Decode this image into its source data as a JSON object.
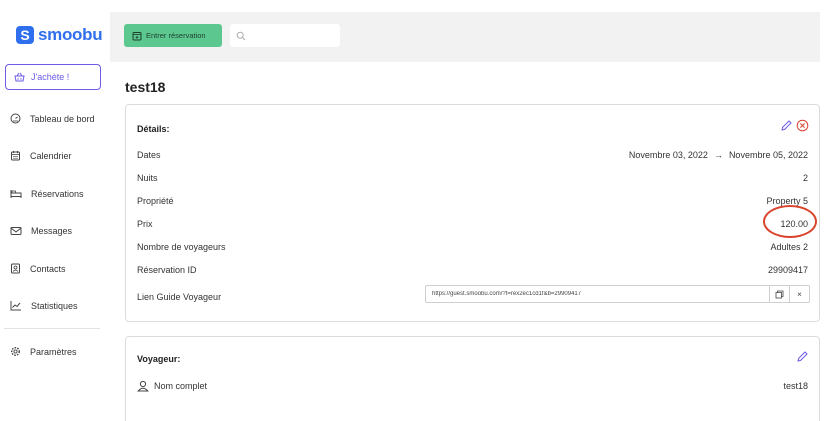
{
  "brand": {
    "name": "smoobu",
    "mark": "S"
  },
  "sidebar": {
    "buy_label": "J'achète !",
    "items": [
      {
        "label": "Tableau de bord",
        "icon": "dashboard-icon"
      },
      {
        "label": "Calendrier",
        "icon": "calendar-icon"
      },
      {
        "label": "Réservations",
        "icon": "bed-icon"
      },
      {
        "label": "Messages",
        "icon": "mail-icon"
      },
      {
        "label": "Contacts",
        "icon": "contact-icon"
      },
      {
        "label": "Statistiques",
        "icon": "chart-icon"
      },
      {
        "label": "Paramètres",
        "icon": "gear-icon"
      }
    ]
  },
  "topbar": {
    "enter_label": "Entrer réservation",
    "search_placeholder": ""
  },
  "page": {
    "title": "test18"
  },
  "details": {
    "title": "Détails:",
    "rows": {
      "dates_label": "Dates",
      "dates_from": "Novembre 03, 2022",
      "dates_arrow": "→",
      "dates_to": "Novembre 05, 2022",
      "nights_label": "Nuits",
      "nights_value": "2",
      "property_label": "Propriété",
      "property_value": "Property 5",
      "price_label": "Prix",
      "price_value": "120.00",
      "guests_label": "Nombre de voyageurs",
      "guests_value": "Adultes 2",
      "reservation_label": "Réservation ID",
      "reservation_value": "29909417",
      "guide_label": "Lien Guide Voyageur",
      "guide_link": "https://guest.smoobu.com/?t=rex2ec1cd1f&b=29909417",
      "close_glyph": "×"
    }
  },
  "voyageur": {
    "title": "Voyageur:",
    "fullname_label": "Nom complet",
    "fullname_value": "test18"
  },
  "colors": {
    "brand": "#2f6fed",
    "accent": "#6c5ce7",
    "enter_button": "#5cc88f",
    "annotation": "#d9442c"
  }
}
